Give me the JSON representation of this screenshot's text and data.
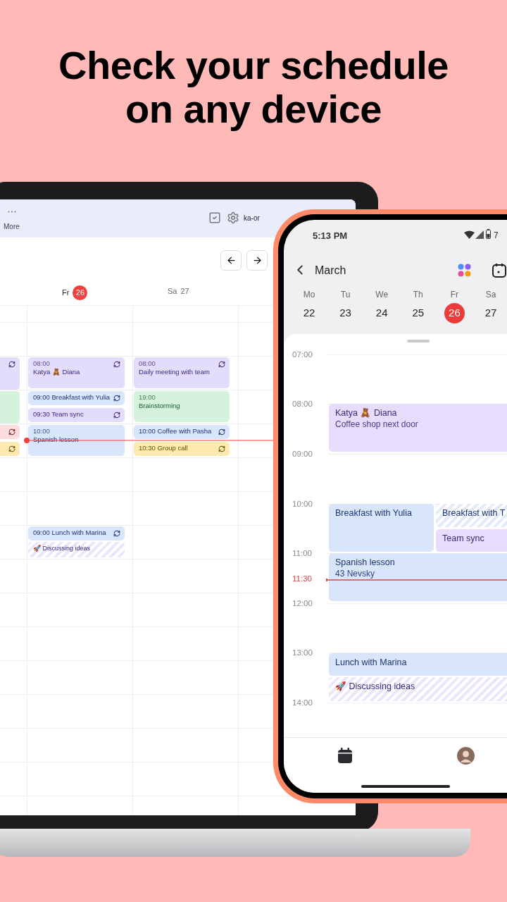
{
  "headline": [
    "Check your schedule",
    "on any device"
  ],
  "laptop": {
    "more_label": "More",
    "account": "ka-or",
    "days": [
      {
        "weekday": "Fr",
        "date": "26",
        "selected": true
      },
      {
        "weekday": "Sa",
        "date": "27",
        "selected": false
      }
    ],
    "columns": [
      {
        "events": [
          {
            "kind": "block",
            "color": "#e4dcfb",
            "recurring": true
          },
          {
            "kind": "block",
            "color": "#d5f2dd",
            "recurring": false
          },
          {
            "kind": "inline",
            "color": "#fcdcdc",
            "recurring": true
          },
          {
            "kind": "inline",
            "color": "#fdeab0",
            "recurring": true
          }
        ]
      },
      {
        "events": [
          {
            "kind": "block",
            "time": "08:00",
            "title": "Katya 🧸 Diana",
            "color": "#e4dcfb",
            "recurring": true
          },
          {
            "kind": "inline",
            "time": "09:00",
            "title": "Breakfast with Yulia",
            "color": "#d8e5fb",
            "recurring": true
          },
          {
            "kind": "inline",
            "time": "09:30",
            "title": "Team sync",
            "color": "#e4dcfb",
            "recurring": true
          },
          {
            "kind": "block",
            "time": "10:00",
            "title": "Spanish lesson",
            "color": "#d8e5fb",
            "recurring": false
          },
          {
            "kind": "inline",
            "time": "09:00",
            "title": "Lunch with Marina",
            "color": "#d8e5fb",
            "recurring": true
          },
          {
            "kind": "hatched",
            "title": "🚀 Discussing ideas",
            "color": "#ece6fd",
            "recurring": false
          }
        ]
      },
      {
        "events": [
          {
            "kind": "block",
            "time": "08:00",
            "title": "Daily meeting with team",
            "color": "#e4dcfb",
            "recurring": true
          },
          {
            "kind": "block",
            "time": "19:00",
            "title": "Brainstorming",
            "color": "#d5f2dd",
            "recurring": false
          },
          {
            "kind": "inline",
            "time": "10:00",
            "title": "Coffee with Pasha",
            "color": "#d8e5fb",
            "recurring": true
          },
          {
            "kind": "inline",
            "time": "10:30",
            "title": "Group call",
            "color": "#fdeab0",
            "recurring": true
          }
        ]
      }
    ]
  },
  "phone": {
    "status_time": "5:13 PM",
    "battery": "7",
    "month": "March",
    "week": [
      {
        "weekday": "Mo",
        "date": "22",
        "selected": false
      },
      {
        "weekday": "Tu",
        "date": "23",
        "selected": false
      },
      {
        "weekday": "We",
        "date": "24",
        "selected": false
      },
      {
        "weekday": "Th",
        "date": "25",
        "selected": false
      },
      {
        "weekday": "Fr",
        "date": "26",
        "selected": true
      },
      {
        "weekday": "Sa",
        "date": "27",
        "selected": false
      }
    ],
    "hours": [
      {
        "label": "07:00",
        "current": false
      },
      {
        "label": "08:00",
        "current": false
      },
      {
        "label": "09:00",
        "current": false
      },
      {
        "label": "10:00",
        "current": false
      },
      {
        "label": "11:00",
        "current": false
      },
      {
        "label": "11:30",
        "current": true
      },
      {
        "label": "12:00",
        "current": false
      },
      {
        "label": "13:00",
        "current": false
      },
      {
        "label": "14:00",
        "current": false
      }
    ],
    "events": [
      {
        "kind": "solid",
        "title": "Katya 🧸 Diana",
        "subtitle": "Coffee shop next door",
        "color": "#e6dcfb"
      },
      {
        "kind": "solid",
        "title": "Breakfast with Yulia",
        "color": "#d8e5fb"
      },
      {
        "kind": "hatched",
        "title": "Breakfast with T",
        "color": "#e3ebfb"
      },
      {
        "kind": "solid",
        "title": "Team sync",
        "color": "#e6dcfb"
      },
      {
        "kind": "solid",
        "title": "Spanish lesson",
        "subtitle": "43 Nevsky",
        "color": "#d8e5fb"
      },
      {
        "kind": "solid",
        "title": "Lunch with Marina",
        "color": "#d8e5fb"
      },
      {
        "kind": "hatched",
        "title": "🚀 Discussing ideas",
        "color": "#ece6fd"
      }
    ]
  }
}
